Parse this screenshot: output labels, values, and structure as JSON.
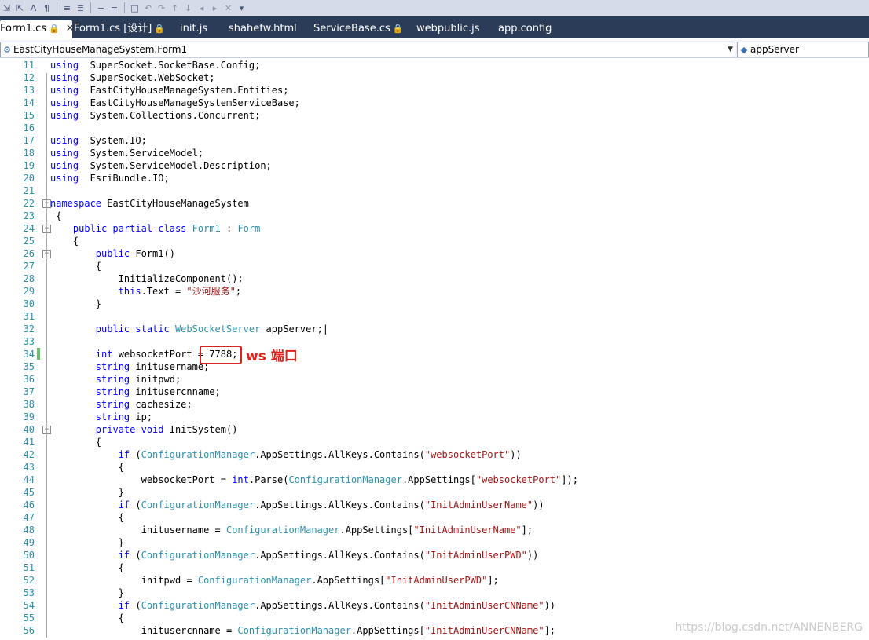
{
  "toolbar": {
    "buttons": [
      "comment-icon",
      "uncomment-icon",
      "format-icon",
      "bookmark-icon",
      "indent-icon",
      "outdent-icon",
      "decrease-icon",
      "increase-icon",
      "view-icon",
      "nav-back-icon",
      "nav-forward-icon",
      "nav-up-icon",
      "nav-down-icon",
      "bookmark-prev-icon",
      "bookmark-next-icon",
      "clear-bookmarks-icon",
      "dropdown-icon"
    ]
  },
  "tabs": [
    {
      "label": "Form1.cs",
      "lock": "🔒",
      "active": true
    },
    {
      "label": "Form1.cs [设计]",
      "lock": "🔒",
      "active": false
    },
    {
      "label": "init.js",
      "active": false
    },
    {
      "label": "shahefw.html",
      "active": false
    },
    {
      "label": "ServiceBase.cs",
      "lock": "🔒",
      "active": false
    },
    {
      "label": "webpublic.js",
      "active": false
    },
    {
      "label": "app.config",
      "active": false
    }
  ],
  "navbar": {
    "type_selector": "EastCityHouseManageSystem.Form1",
    "member_selector": "appServer"
  },
  "code_lines": [
    {
      "n": "11",
      "tokens": [
        [
          "kw",
          "using"
        ],
        [
          "",
          "  SuperSocket.SocketBase.Config;"
        ]
      ]
    },
    {
      "n": "12",
      "tokens": [
        [
          "kw",
          "using"
        ],
        [
          "",
          "  SuperSocket.WebSocket;"
        ]
      ]
    },
    {
      "n": "13",
      "tokens": [
        [
          "kw",
          "using"
        ],
        [
          "",
          "  EastCityHouseManageSystem.Entities;"
        ]
      ]
    },
    {
      "n": "14",
      "tokens": [
        [
          "kw",
          "using"
        ],
        [
          "",
          "  EastCityHouseManageSystemServiceBase;"
        ]
      ]
    },
    {
      "n": "15",
      "tokens": [
        [
          "kw",
          "using"
        ],
        [
          "",
          "  System.Collections.Concurrent;"
        ]
      ]
    },
    {
      "n": "16",
      "tokens": []
    },
    {
      "n": "17",
      "tokens": [
        [
          "kw",
          "using"
        ],
        [
          "",
          "  System.IO;"
        ]
      ]
    },
    {
      "n": "18",
      "tokens": [
        [
          "kw",
          "using"
        ],
        [
          "",
          "  System.ServiceModel;"
        ]
      ]
    },
    {
      "n": "19",
      "tokens": [
        [
          "kw",
          "using"
        ],
        [
          "",
          "  System.ServiceModel.Description;"
        ]
      ]
    },
    {
      "n": "20",
      "tokens": [
        [
          "kw",
          "using"
        ],
        [
          "",
          "  EsriBundle.IO;"
        ]
      ]
    },
    {
      "n": "21",
      "tokens": []
    },
    {
      "n": "22",
      "tokens": [
        [
          "kw",
          "namespace"
        ],
        [
          "",
          " EastCityHouseManageSystem"
        ]
      ]
    },
    {
      "n": "23",
      "tokens": [
        [
          "",
          " {"
        ]
      ]
    },
    {
      "n": "24",
      "tokens": [
        [
          "",
          "    "
        ],
        [
          "kw",
          "public partial class"
        ],
        [
          "",
          " "
        ],
        [
          "ty",
          "Form1"
        ],
        [
          "",
          " : "
        ],
        [
          "ty",
          "Form"
        ]
      ]
    },
    {
      "n": "25",
      "tokens": [
        [
          "",
          "    {"
        ]
      ]
    },
    {
      "n": "26",
      "tokens": [
        [
          "",
          "        "
        ],
        [
          "kw",
          "public"
        ],
        [
          "",
          " Form1()"
        ]
      ]
    },
    {
      "n": "27",
      "tokens": [
        [
          "",
          "        {"
        ]
      ]
    },
    {
      "n": "28",
      "tokens": [
        [
          "",
          "            InitializeComponent();"
        ]
      ]
    },
    {
      "n": "29",
      "tokens": [
        [
          "",
          "            "
        ],
        [
          "kw",
          "this"
        ],
        [
          "",
          ".Text = "
        ],
        [
          "st",
          "\"沙河服务\""
        ],
        [
          "",
          ";"
        ]
      ]
    },
    {
      "n": "30",
      "tokens": [
        [
          "",
          "        }"
        ]
      ]
    },
    {
      "n": "31",
      "tokens": []
    },
    {
      "n": "32",
      "tokens": [
        [
          "",
          "        "
        ],
        [
          "kw",
          "public static"
        ],
        [
          "",
          " "
        ],
        [
          "ty",
          "WebSocketServer"
        ],
        [
          "",
          " appServer;|"
        ]
      ]
    },
    {
      "n": "33",
      "tokens": []
    },
    {
      "n": "34",
      "tokens": [
        [
          "",
          "        "
        ],
        [
          "kw",
          "int"
        ],
        [
          "",
          " websocketPort = 7788;"
        ]
      ]
    },
    {
      "n": "35",
      "tokens": [
        [
          "",
          "        "
        ],
        [
          "kw",
          "string"
        ],
        [
          "",
          " initusername;"
        ]
      ]
    },
    {
      "n": "36",
      "tokens": [
        [
          "",
          "        "
        ],
        [
          "kw",
          "string"
        ],
        [
          "",
          " initpwd;"
        ]
      ]
    },
    {
      "n": "37",
      "tokens": [
        [
          "",
          "        "
        ],
        [
          "kw",
          "string"
        ],
        [
          "",
          " initusercnname;"
        ]
      ]
    },
    {
      "n": "38",
      "tokens": [
        [
          "",
          "        "
        ],
        [
          "kw",
          "string"
        ],
        [
          "",
          " cachesize;"
        ]
      ]
    },
    {
      "n": "39",
      "tokens": [
        [
          "",
          "        "
        ],
        [
          "kw",
          "string"
        ],
        [
          "",
          " ip;"
        ]
      ]
    },
    {
      "n": "40",
      "tokens": [
        [
          "",
          "        "
        ],
        [
          "kw",
          "private void"
        ],
        [
          "",
          " InitSystem()"
        ]
      ]
    },
    {
      "n": "41",
      "tokens": [
        [
          "",
          "        {"
        ]
      ]
    },
    {
      "n": "42",
      "tokens": [
        [
          "",
          "            "
        ],
        [
          "kw",
          "if"
        ],
        [
          "",
          " ("
        ],
        [
          "ty",
          "ConfigurationManager"
        ],
        [
          "",
          ".AppSettings.AllKeys.Contains("
        ],
        [
          "st",
          "\"websocketPort\""
        ],
        [
          "",
          "))"
        ]
      ]
    },
    {
      "n": "43",
      "tokens": [
        [
          "",
          "            {"
        ]
      ]
    },
    {
      "n": "44",
      "tokens": [
        [
          "",
          "                websocketPort = "
        ],
        [
          "kw",
          "int"
        ],
        [
          "",
          ".Parse("
        ],
        [
          "ty",
          "ConfigurationManager"
        ],
        [
          "",
          ".AppSettings["
        ],
        [
          "st",
          "\"websocketPort\""
        ],
        [
          "",
          "]);"
        ]
      ]
    },
    {
      "n": "45",
      "tokens": [
        [
          "",
          "            }"
        ]
      ]
    },
    {
      "n": "46",
      "tokens": [
        [
          "",
          "            "
        ],
        [
          "kw",
          "if"
        ],
        [
          "",
          " ("
        ],
        [
          "ty",
          "ConfigurationManager"
        ],
        [
          "",
          ".AppSettings.AllKeys.Contains("
        ],
        [
          "st",
          "\"InitAdminUserName\""
        ],
        [
          "",
          "))"
        ]
      ]
    },
    {
      "n": "47",
      "tokens": [
        [
          "",
          "            {"
        ]
      ]
    },
    {
      "n": "48",
      "tokens": [
        [
          "",
          "                initusername = "
        ],
        [
          "ty",
          "ConfigurationManager"
        ],
        [
          "",
          ".AppSettings["
        ],
        [
          "st",
          "\"InitAdminUserName\""
        ],
        [
          "",
          "];"
        ]
      ]
    },
    {
      "n": "49",
      "tokens": [
        [
          "",
          "            }"
        ]
      ]
    },
    {
      "n": "50",
      "tokens": [
        [
          "",
          "            "
        ],
        [
          "kw",
          "if"
        ],
        [
          "",
          " ("
        ],
        [
          "ty",
          "ConfigurationManager"
        ],
        [
          "",
          ".AppSettings.AllKeys.Contains("
        ],
        [
          "st",
          "\"InitAdminUserPWD\""
        ],
        [
          "",
          "))"
        ]
      ]
    },
    {
      "n": "51",
      "tokens": [
        [
          "",
          "            {"
        ]
      ]
    },
    {
      "n": "52",
      "tokens": [
        [
          "",
          "                initpwd = "
        ],
        [
          "ty",
          "ConfigurationManager"
        ],
        [
          "",
          ".AppSettings["
        ],
        [
          "st",
          "\"InitAdminUserPWD\""
        ],
        [
          "",
          "];"
        ]
      ]
    },
    {
      "n": "53",
      "tokens": [
        [
          "",
          "            }"
        ]
      ]
    },
    {
      "n": "54",
      "tokens": [
        [
          "",
          "            "
        ],
        [
          "kw",
          "if"
        ],
        [
          "",
          " ("
        ],
        [
          "ty",
          "ConfigurationManager"
        ],
        [
          "",
          ".AppSettings.AllKeys.Contains("
        ],
        [
          "st",
          "\"InitAdminUserCNName\""
        ],
        [
          "",
          "))"
        ]
      ]
    },
    {
      "n": "55",
      "tokens": [
        [
          "",
          "            {"
        ]
      ]
    },
    {
      "n": "56",
      "tokens": [
        [
          "",
          "                initusercnname = "
        ],
        [
          "ty",
          "ConfigurationManager"
        ],
        [
          "",
          ".AppSettings["
        ],
        [
          "st",
          "\"InitAdminUserCNName\""
        ],
        [
          "",
          "];"
        ]
      ]
    }
  ],
  "annotation": {
    "label": "ws 端口",
    "color": "#e0201b"
  },
  "watermark": "https://blog.csdn.net/ANNENBERG",
  "colors": {
    "keyword": "#0000ff",
    "type": "#2b91af",
    "string": "#a31515",
    "line_number": "#2b91af",
    "tab_strip": "#2b3c59"
  }
}
